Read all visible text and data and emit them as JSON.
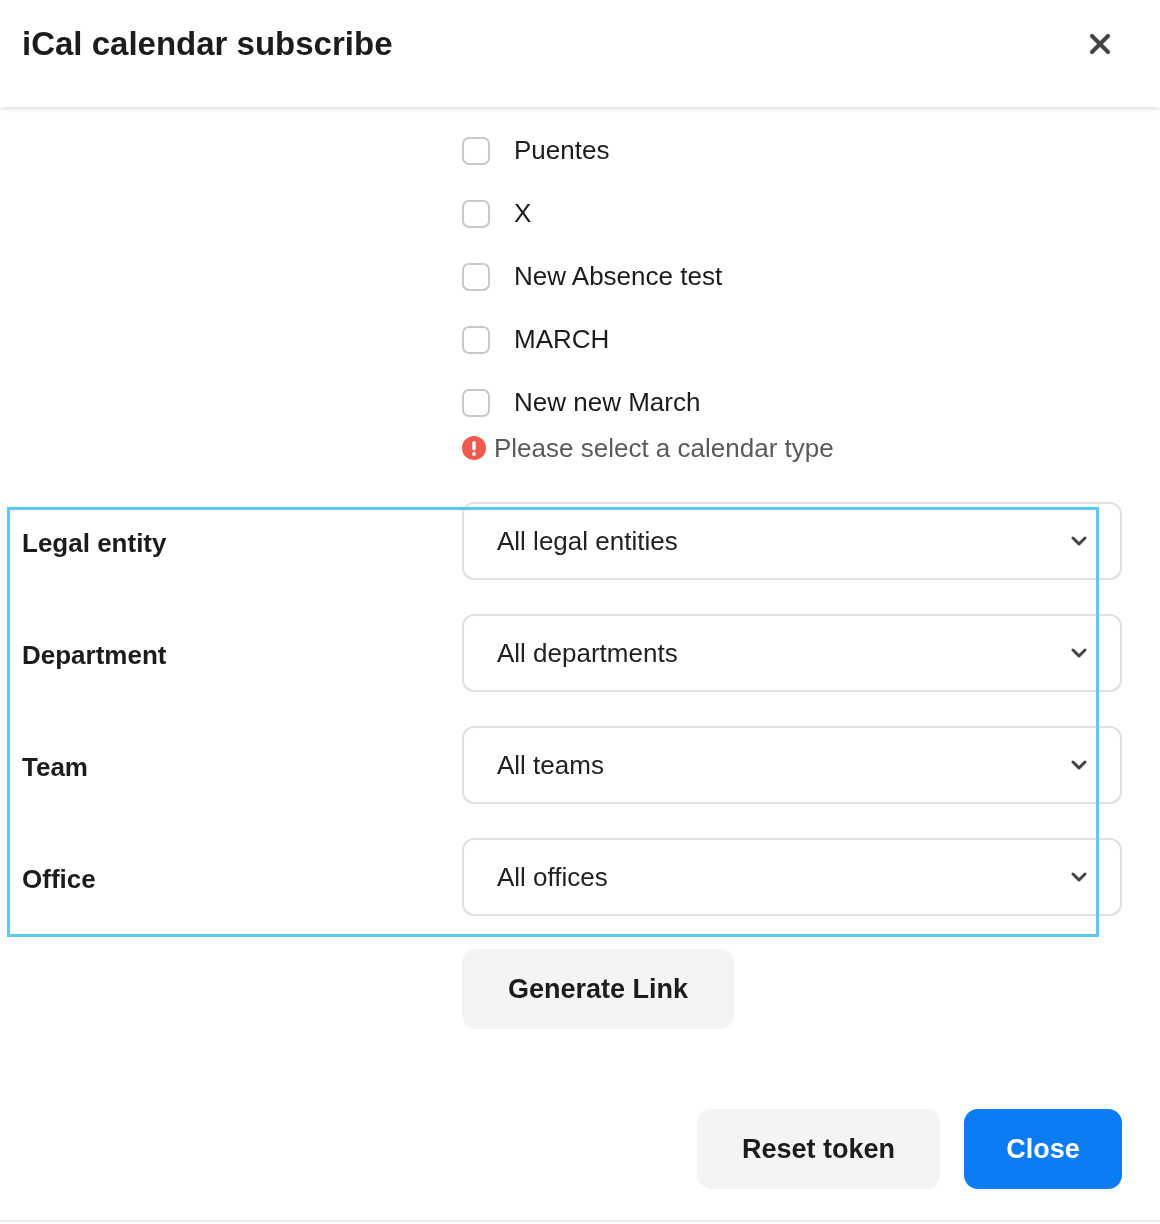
{
  "dialog": {
    "title": "iCal calendar subscribe"
  },
  "calendar_types": [
    {
      "label": "Puentes",
      "checked": false
    },
    {
      "label": "X",
      "checked": false
    },
    {
      "label": "New Absence test",
      "checked": false
    },
    {
      "label": "MARCH",
      "checked": false
    },
    {
      "label": "New new March",
      "checked": false
    }
  ],
  "validation_error": {
    "message": "Please select a calendar type"
  },
  "filters": {
    "highlighted": true,
    "rows": [
      {
        "label": "Legal entity",
        "value": "All legal entities"
      },
      {
        "label": "Department",
        "value": "All departments"
      },
      {
        "label": "Team",
        "value": "All teams"
      },
      {
        "label": "Office",
        "value": "All offices"
      }
    ]
  },
  "generate_button": {
    "label": "Generate Link"
  },
  "footer_buttons": [
    {
      "label": "Reset token",
      "kind": "secondary"
    },
    {
      "label": "Close",
      "kind": "primary"
    }
  ]
}
